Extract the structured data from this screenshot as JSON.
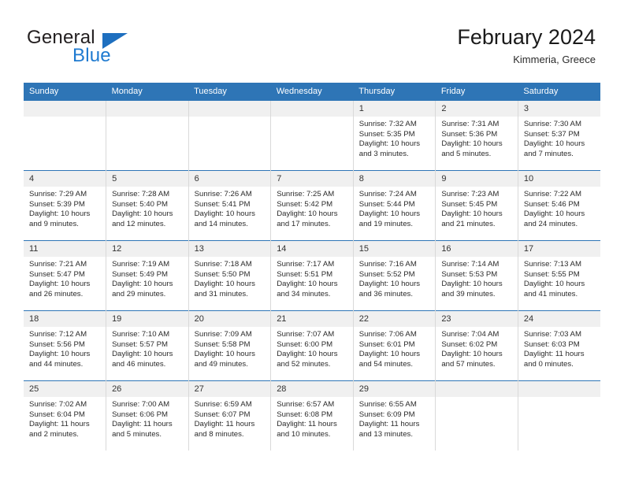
{
  "brand": {
    "name_top": "General",
    "name_bottom": "Blue",
    "triangle_icon": "blue-triangle-logo",
    "color_dark": "#231f20",
    "color_blue": "#1e7ad0"
  },
  "header": {
    "title": "February 2024",
    "subtitle": "Kimmeria, Greece"
  },
  "theme": {
    "header_row_bg": "#2e75b6",
    "daynum_bg": "#f0f0f0",
    "grid_line": "#d9d9d9",
    "week_divider": "#2e75b6"
  },
  "weekdays": [
    "Sunday",
    "Monday",
    "Tuesday",
    "Wednesday",
    "Thursday",
    "Friday",
    "Saturday"
  ],
  "weeks": [
    [
      {
        "empty": true,
        "day": "",
        "sunrise": "",
        "sunset": "",
        "daylight_1": "",
        "daylight_2": ""
      },
      {
        "empty": true,
        "day": "",
        "sunrise": "",
        "sunset": "",
        "daylight_1": "",
        "daylight_2": ""
      },
      {
        "empty": true,
        "day": "",
        "sunrise": "",
        "sunset": "",
        "daylight_1": "",
        "daylight_2": ""
      },
      {
        "empty": true,
        "day": "",
        "sunrise": "",
        "sunset": "",
        "daylight_1": "",
        "daylight_2": ""
      },
      {
        "empty": false,
        "day": "1",
        "sunrise": "Sunrise: 7:32 AM",
        "sunset": "Sunset: 5:35 PM",
        "daylight_1": "Daylight: 10 hours",
        "daylight_2": "and 3 minutes."
      },
      {
        "empty": false,
        "day": "2",
        "sunrise": "Sunrise: 7:31 AM",
        "sunset": "Sunset: 5:36 PM",
        "daylight_1": "Daylight: 10 hours",
        "daylight_2": "and 5 minutes."
      },
      {
        "empty": false,
        "day": "3",
        "sunrise": "Sunrise: 7:30 AM",
        "sunset": "Sunset: 5:37 PM",
        "daylight_1": "Daylight: 10 hours",
        "daylight_2": "and 7 minutes."
      }
    ],
    [
      {
        "empty": false,
        "day": "4",
        "sunrise": "Sunrise: 7:29 AM",
        "sunset": "Sunset: 5:39 PM",
        "daylight_1": "Daylight: 10 hours",
        "daylight_2": "and 9 minutes."
      },
      {
        "empty": false,
        "day": "5",
        "sunrise": "Sunrise: 7:28 AM",
        "sunset": "Sunset: 5:40 PM",
        "daylight_1": "Daylight: 10 hours",
        "daylight_2": "and 12 minutes."
      },
      {
        "empty": false,
        "day": "6",
        "sunrise": "Sunrise: 7:26 AM",
        "sunset": "Sunset: 5:41 PM",
        "daylight_1": "Daylight: 10 hours",
        "daylight_2": "and 14 minutes."
      },
      {
        "empty": false,
        "day": "7",
        "sunrise": "Sunrise: 7:25 AM",
        "sunset": "Sunset: 5:42 PM",
        "daylight_1": "Daylight: 10 hours",
        "daylight_2": "and 17 minutes."
      },
      {
        "empty": false,
        "day": "8",
        "sunrise": "Sunrise: 7:24 AM",
        "sunset": "Sunset: 5:44 PM",
        "daylight_1": "Daylight: 10 hours",
        "daylight_2": "and 19 minutes."
      },
      {
        "empty": false,
        "day": "9",
        "sunrise": "Sunrise: 7:23 AM",
        "sunset": "Sunset: 5:45 PM",
        "daylight_1": "Daylight: 10 hours",
        "daylight_2": "and 21 minutes."
      },
      {
        "empty": false,
        "day": "10",
        "sunrise": "Sunrise: 7:22 AM",
        "sunset": "Sunset: 5:46 PM",
        "daylight_1": "Daylight: 10 hours",
        "daylight_2": "and 24 minutes."
      }
    ],
    [
      {
        "empty": false,
        "day": "11",
        "sunrise": "Sunrise: 7:21 AM",
        "sunset": "Sunset: 5:47 PM",
        "daylight_1": "Daylight: 10 hours",
        "daylight_2": "and 26 minutes."
      },
      {
        "empty": false,
        "day": "12",
        "sunrise": "Sunrise: 7:19 AM",
        "sunset": "Sunset: 5:49 PM",
        "daylight_1": "Daylight: 10 hours",
        "daylight_2": "and 29 minutes."
      },
      {
        "empty": false,
        "day": "13",
        "sunrise": "Sunrise: 7:18 AM",
        "sunset": "Sunset: 5:50 PM",
        "daylight_1": "Daylight: 10 hours",
        "daylight_2": "and 31 minutes."
      },
      {
        "empty": false,
        "day": "14",
        "sunrise": "Sunrise: 7:17 AM",
        "sunset": "Sunset: 5:51 PM",
        "daylight_1": "Daylight: 10 hours",
        "daylight_2": "and 34 minutes."
      },
      {
        "empty": false,
        "day": "15",
        "sunrise": "Sunrise: 7:16 AM",
        "sunset": "Sunset: 5:52 PM",
        "daylight_1": "Daylight: 10 hours",
        "daylight_2": "and 36 minutes."
      },
      {
        "empty": false,
        "day": "16",
        "sunrise": "Sunrise: 7:14 AM",
        "sunset": "Sunset: 5:53 PM",
        "daylight_1": "Daylight: 10 hours",
        "daylight_2": "and 39 minutes."
      },
      {
        "empty": false,
        "day": "17",
        "sunrise": "Sunrise: 7:13 AM",
        "sunset": "Sunset: 5:55 PM",
        "daylight_1": "Daylight: 10 hours",
        "daylight_2": "and 41 minutes."
      }
    ],
    [
      {
        "empty": false,
        "day": "18",
        "sunrise": "Sunrise: 7:12 AM",
        "sunset": "Sunset: 5:56 PM",
        "daylight_1": "Daylight: 10 hours",
        "daylight_2": "and 44 minutes."
      },
      {
        "empty": false,
        "day": "19",
        "sunrise": "Sunrise: 7:10 AM",
        "sunset": "Sunset: 5:57 PM",
        "daylight_1": "Daylight: 10 hours",
        "daylight_2": "and 46 minutes."
      },
      {
        "empty": false,
        "day": "20",
        "sunrise": "Sunrise: 7:09 AM",
        "sunset": "Sunset: 5:58 PM",
        "daylight_1": "Daylight: 10 hours",
        "daylight_2": "and 49 minutes."
      },
      {
        "empty": false,
        "day": "21",
        "sunrise": "Sunrise: 7:07 AM",
        "sunset": "Sunset: 6:00 PM",
        "daylight_1": "Daylight: 10 hours",
        "daylight_2": "and 52 minutes."
      },
      {
        "empty": false,
        "day": "22",
        "sunrise": "Sunrise: 7:06 AM",
        "sunset": "Sunset: 6:01 PM",
        "daylight_1": "Daylight: 10 hours",
        "daylight_2": "and 54 minutes."
      },
      {
        "empty": false,
        "day": "23",
        "sunrise": "Sunrise: 7:04 AM",
        "sunset": "Sunset: 6:02 PM",
        "daylight_1": "Daylight: 10 hours",
        "daylight_2": "and 57 minutes."
      },
      {
        "empty": false,
        "day": "24",
        "sunrise": "Sunrise: 7:03 AM",
        "sunset": "Sunset: 6:03 PM",
        "daylight_1": "Daylight: 11 hours",
        "daylight_2": "and 0 minutes."
      }
    ],
    [
      {
        "empty": false,
        "day": "25",
        "sunrise": "Sunrise: 7:02 AM",
        "sunset": "Sunset: 6:04 PM",
        "daylight_1": "Daylight: 11 hours",
        "daylight_2": "and 2 minutes."
      },
      {
        "empty": false,
        "day": "26",
        "sunrise": "Sunrise: 7:00 AM",
        "sunset": "Sunset: 6:06 PM",
        "daylight_1": "Daylight: 11 hours",
        "daylight_2": "and 5 minutes."
      },
      {
        "empty": false,
        "day": "27",
        "sunrise": "Sunrise: 6:59 AM",
        "sunset": "Sunset: 6:07 PM",
        "daylight_1": "Daylight: 11 hours",
        "daylight_2": "and 8 minutes."
      },
      {
        "empty": false,
        "day": "28",
        "sunrise": "Sunrise: 6:57 AM",
        "sunset": "Sunset: 6:08 PM",
        "daylight_1": "Daylight: 11 hours",
        "daylight_2": "and 10 minutes."
      },
      {
        "empty": false,
        "day": "29",
        "sunrise": "Sunrise: 6:55 AM",
        "sunset": "Sunset: 6:09 PM",
        "daylight_1": "Daylight: 11 hours",
        "daylight_2": "and 13 minutes."
      },
      {
        "empty": true,
        "day": "",
        "sunrise": "",
        "sunset": "",
        "daylight_1": "",
        "daylight_2": ""
      },
      {
        "empty": true,
        "day": "",
        "sunrise": "",
        "sunset": "",
        "daylight_1": "",
        "daylight_2": ""
      }
    ]
  ]
}
